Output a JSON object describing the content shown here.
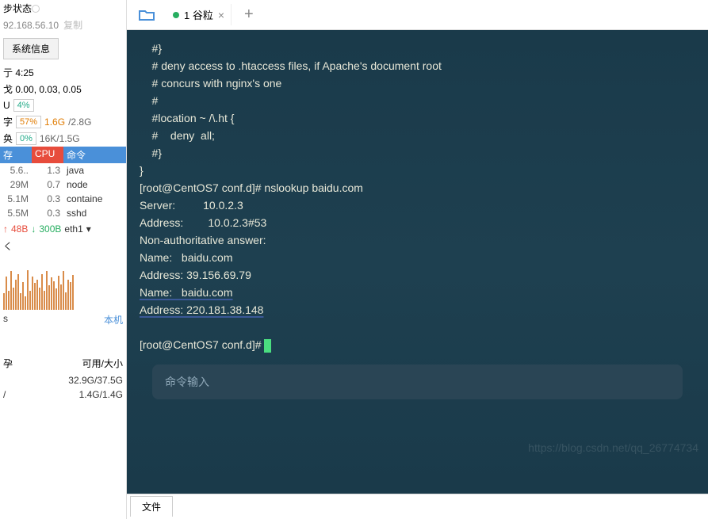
{
  "left": {
    "status_label": "步状态",
    "ip": "92.168.56.10",
    "copy_label": "复制",
    "sysinfo_btn": "系统信息",
    "uptime_label": "亍 4:25",
    "load_label": "戈 0.00, 0.03, 0.05",
    "cpu_label": "U",
    "cpu_pct": "4%",
    "mem_label": "字",
    "mem_pct": "57%",
    "mem_val": "1.6G",
    "mem_total": "/2.8G",
    "swap_label": "奂",
    "swap_pct": "0%",
    "swap_val": "16K/1.5G",
    "proc_headers": {
      "mem": "存",
      "cpu": "CPU",
      "cmd": "命令"
    },
    "processes": [
      {
        "mem": "5.6..",
        "cpu": "1.3",
        "cmd": "java"
      },
      {
        "mem": "29M",
        "cpu": "0.7",
        "cmd": "node"
      },
      {
        "mem": "5.1M",
        "cpu": "0.3",
        "cmd": "containe"
      },
      {
        "mem": "5.5M",
        "cpu": "0.3",
        "cmd": "sshd"
      }
    ],
    "net_up": "48B",
    "net_down": "300B",
    "net_iface": "eth1",
    "s_label": "s",
    "s_local": "本机",
    "disk_j": "孕",
    "disk_avail_label": "可用/大小",
    "disks": [
      "32.9G/37.5G",
      "1.4G/1.4G"
    ]
  },
  "tabs": {
    "tab1_label": "1 谷粒",
    "add_label": "+"
  },
  "terminal": {
    "lines": [
      "    #}",
      "",
      "    # deny access to .htaccess files, if Apache's document root",
      "    # concurs with nginx's one",
      "    #",
      "    #location ~ /\\.ht {",
      "    #    deny  all;",
      "    #}",
      "}",
      "",
      "[root@CentOS7 conf.d]# nslookup baidu.com",
      "Server:         10.0.2.3",
      "Address:        10.0.2.3#53",
      "",
      "Non-authoritative answer:",
      "Name:   baidu.com",
      "Address: 39.156.69.79"
    ],
    "annot_name": "Name:   baidu.com",
    "annot_addr": "Address: 220.181.38.148",
    "prompt": "[root@CentOS7 conf.d]# ",
    "cmd_input_placeholder": "命令输入",
    "watermark": "https://blog.csdn.net/qq_26774734"
  },
  "bottom": {
    "tab1": "文件"
  }
}
